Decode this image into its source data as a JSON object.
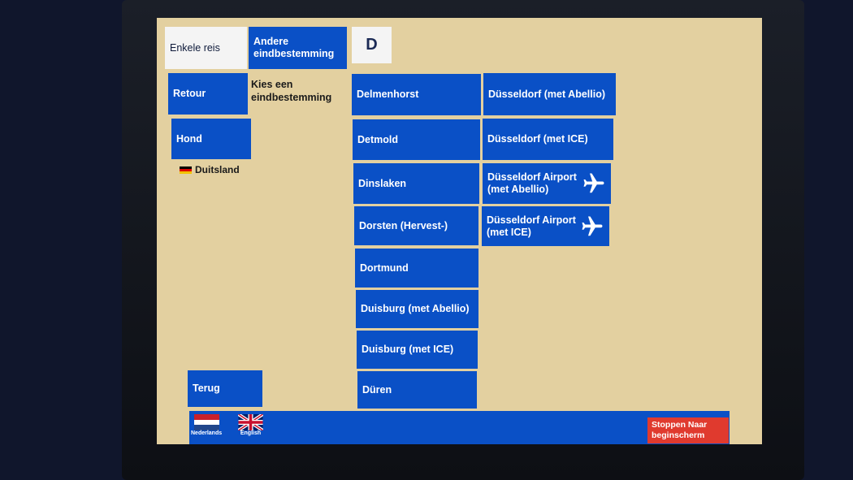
{
  "ticket_type": {
    "single": "Enkele reis",
    "return": "Retour",
    "dog": "Hond"
  },
  "other_destination": "Andere eindbestemming",
  "current_letter": "D",
  "prompt": "Kies een eindbestemming",
  "country": "Duitsland",
  "destinations_col1": [
    "Delmenhorst",
    "Detmold",
    "Dinslaken",
    "Dorsten (Hervest-)",
    "Dortmund",
    "Duisburg (met Abellio)",
    "Duisburg (met ICE)",
    "Düren"
  ],
  "destinations_col2": [
    "Düsseldorf (met Abellio)",
    "Düsseldorf (met ICE)",
    "Düsseldorf Airport (met Abellio)",
    "Düsseldorf Airport (met ICE)"
  ],
  "back": "Terug",
  "languages": [
    "Nederlands",
    "English"
  ],
  "stop": "Stoppen Naar beginscherm",
  "icons": {
    "airport": "airplane-icon"
  },
  "colors": {
    "button": "#0a50c6",
    "background": "#e3d0a0",
    "stop": "#e03a2e"
  }
}
